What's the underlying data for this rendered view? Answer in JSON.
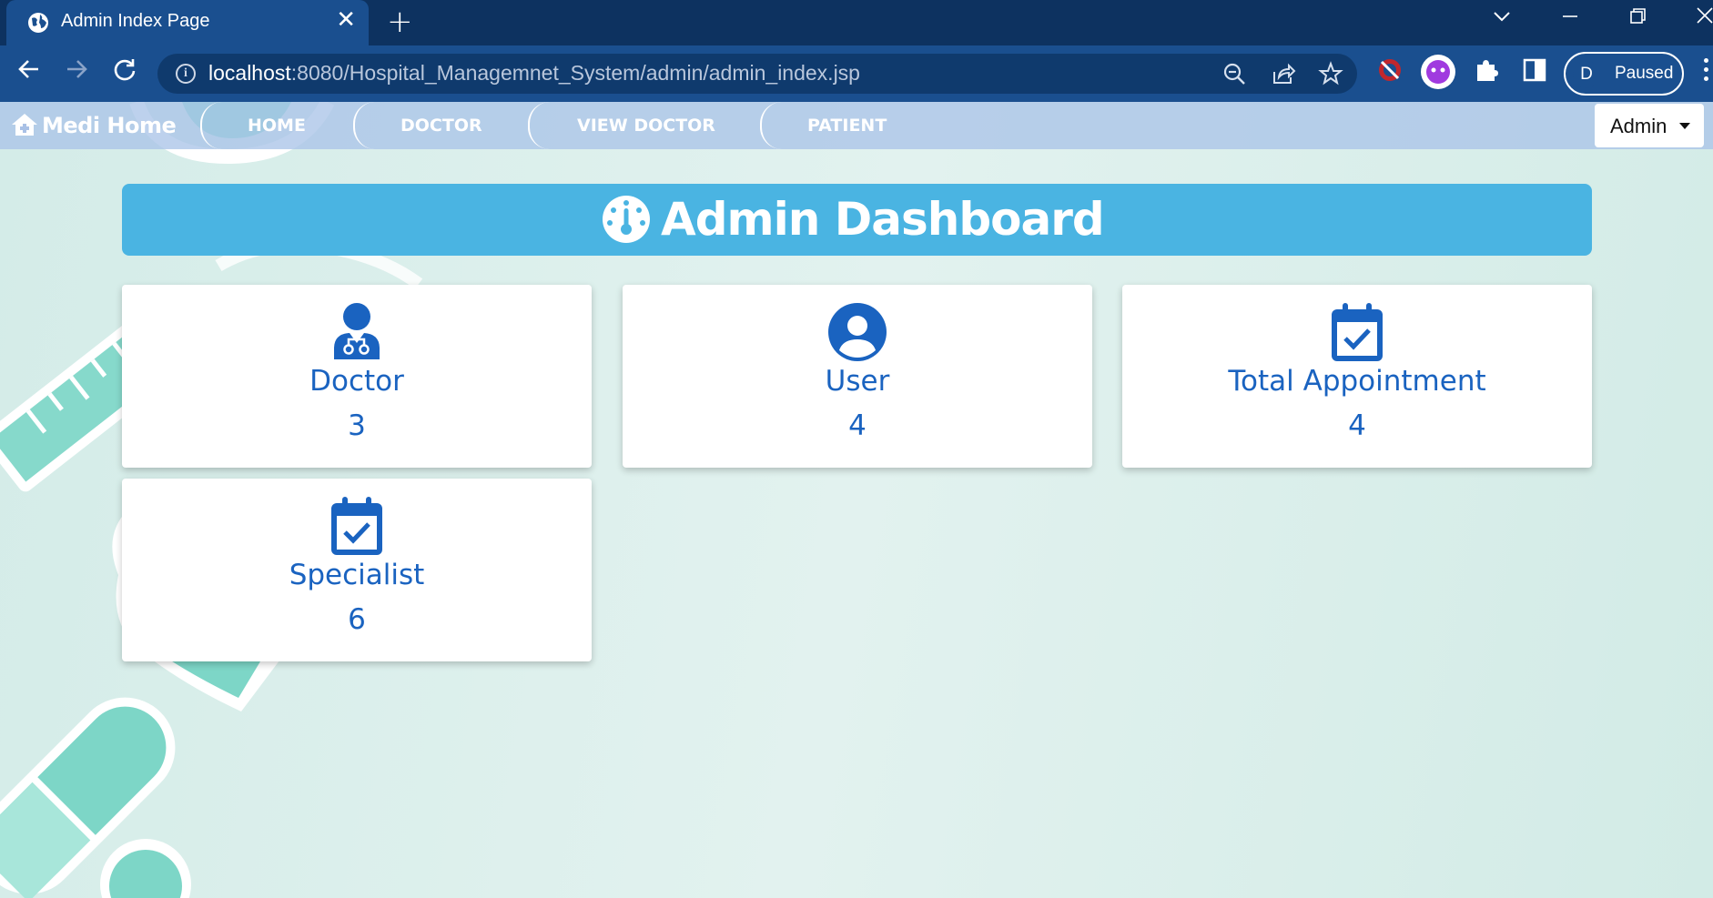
{
  "browser": {
    "tab_title": "Admin Index Page",
    "url_host": "localhost",
    "url_rest": ":8080/Hospital_Managemnet_System/admin/admin_index.jsp",
    "profile_initial": "D",
    "profile_status": "Paused"
  },
  "nav": {
    "brand": "Medi Home",
    "links": [
      "HOME",
      "DOCTOR",
      "VIEW DOCTOR",
      "PATIENT"
    ],
    "admin_label": "Admin"
  },
  "dashboard": {
    "title": "Admin Dashboard",
    "cards": [
      {
        "label": "Doctor",
        "value": "3",
        "icon": "doctor-icon"
      },
      {
        "label": "User",
        "value": "4",
        "icon": "user-circle-icon"
      },
      {
        "label": "Total Appointment",
        "value": "4",
        "icon": "calendar-check-icon"
      },
      {
        "label": "Specialist",
        "value": "6",
        "icon": "calendar-check-icon"
      }
    ]
  },
  "colors": {
    "accent_blue": "#1a63c0",
    "banner": "#4ab4e2",
    "chrome": "#1a4f8f"
  }
}
